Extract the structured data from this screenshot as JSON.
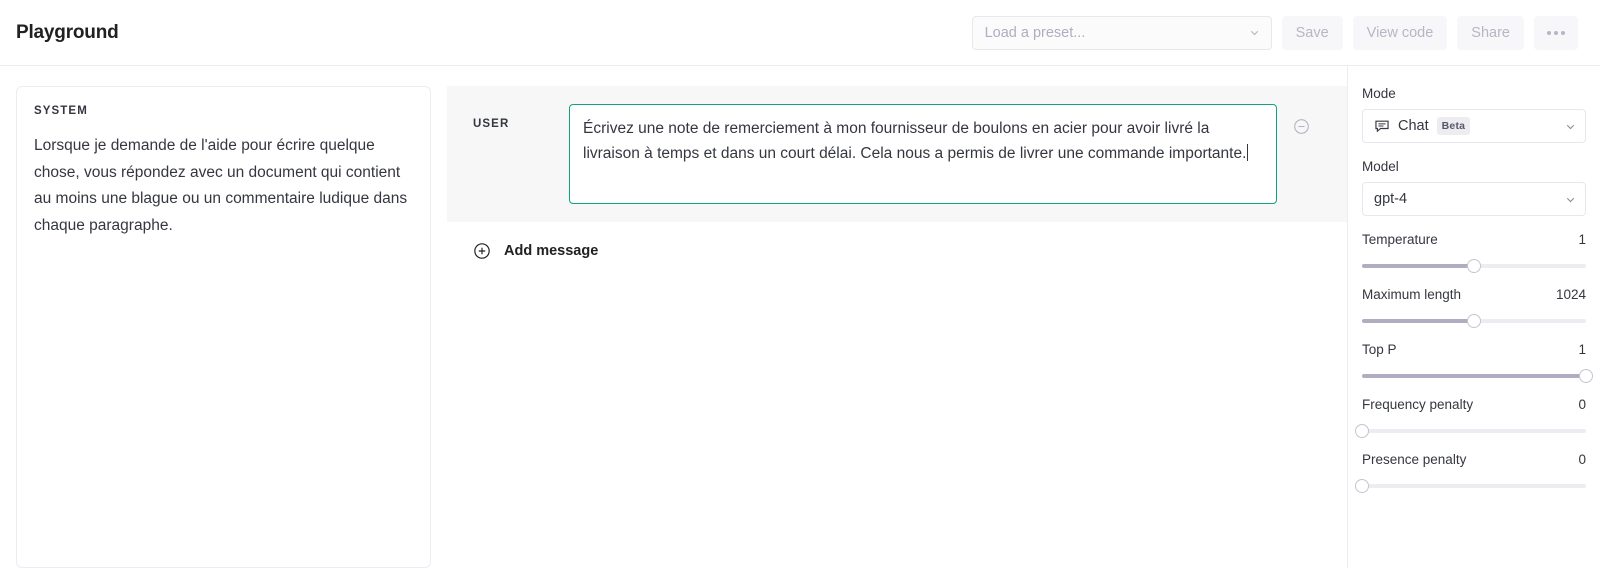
{
  "header": {
    "title": "Playground",
    "preset_placeholder": "Load a preset...",
    "buttons": [
      {
        "label": "Save",
        "name": "save-button"
      },
      {
        "label": "View code",
        "name": "view-code-button"
      },
      {
        "label": "Share",
        "name": "share-button"
      }
    ],
    "more_label": "•••"
  },
  "system": {
    "role_label": "SYSTEM",
    "text": "Lorsque je demande de l'aide pour écrire quelque chose, vous répondez avec un document qui contient au moins une blague ou un commentaire ludique dans chaque paragraphe."
  },
  "messages": {
    "user": {
      "role_label": "USER",
      "text": "Écrivez une note de remerciement à mon fournisseur de boulons en acier pour avoir livré la livraison à temps et dans un court délai. Cela nous a permis de livrer une commande importante."
    },
    "add_label": "Add message"
  },
  "sidebar": {
    "mode_label": "Mode",
    "mode_value": "Chat",
    "mode_badge": "Beta",
    "model_label": "Model",
    "model_value": "gpt-4",
    "params": [
      {
        "name": "Temperature",
        "value": "1",
        "percent": 50
      },
      {
        "name": "Maximum length",
        "value": "1024",
        "percent": 50
      },
      {
        "name": "Top P",
        "value": "1",
        "percent": 100
      },
      {
        "name": "Frequency penalty",
        "value": "0",
        "percent": 0
      },
      {
        "name": "Presence penalty",
        "value": "0",
        "percent": 0
      }
    ]
  },
  "colors": {
    "accent": "#11a37f",
    "muted": "#aeaec0",
    "border": "#ececf1",
    "row_bg": "#f7f7f8"
  }
}
